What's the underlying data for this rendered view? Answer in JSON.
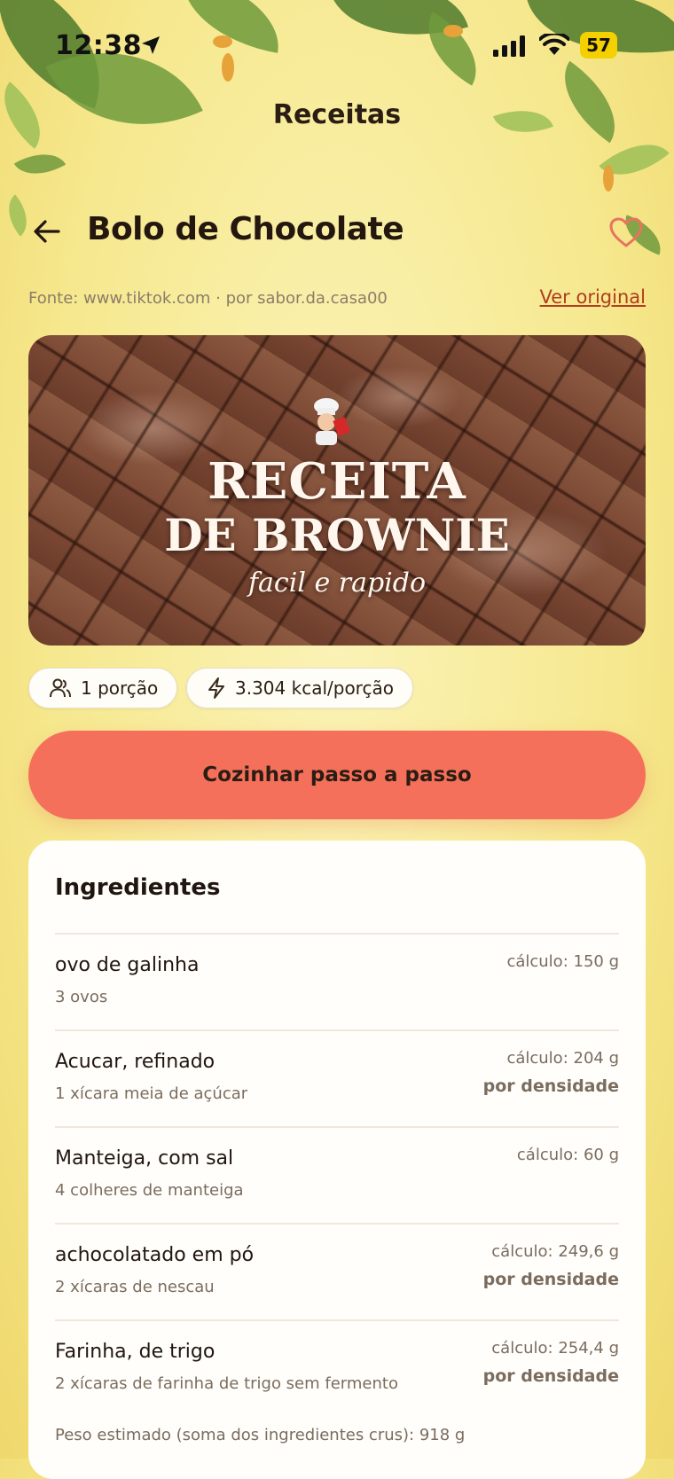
{
  "status_bar": {
    "time": "12:38",
    "battery": "57"
  },
  "header": {
    "title": "Receitas"
  },
  "recipe": {
    "title": "Bolo de Chocolate",
    "source": "Fonte: www.tiktok.com · por sabor.da.casa00",
    "view_original": "Ver original",
    "image": {
      "line1": "RECEITA",
      "line2": "DE BROWNIE",
      "line3": "facil e rapido"
    },
    "portions": "1 porção",
    "calories": "3.304 kcal/porção",
    "cook_button": "Cozinhar passo a passo"
  },
  "ingredients": {
    "title": "Ingredientes",
    "items": [
      {
        "name": "ovo de galinha",
        "quantity": "3 ovos",
        "calc": "cálculo: 150 g",
        "density": ""
      },
      {
        "name": "Acucar, refinado",
        "quantity": "1 xícara meia de açúcar",
        "calc": "cálculo: 204 g",
        "density": "por densidade"
      },
      {
        "name": "Manteiga, com sal",
        "quantity": "4 colheres de manteiga",
        "calc": "cálculo: 60 g",
        "density": ""
      },
      {
        "name": "achocolatado em pó",
        "quantity": "2 xícaras de nescau",
        "calc": "cálculo: 249,6 g",
        "density": "por densidade"
      },
      {
        "name": "Farinha, de trigo",
        "quantity": "2 xícaras de farinha de trigo sem fermento",
        "calc": "cálculo: 254,4 g",
        "density": "por densidade"
      }
    ],
    "total": "Peso estimado (soma dos ingredientes crus): 918 g"
  },
  "colors": {
    "accent": "#f4705a",
    "link": "#b13c1f",
    "background": "#f6e88e"
  }
}
